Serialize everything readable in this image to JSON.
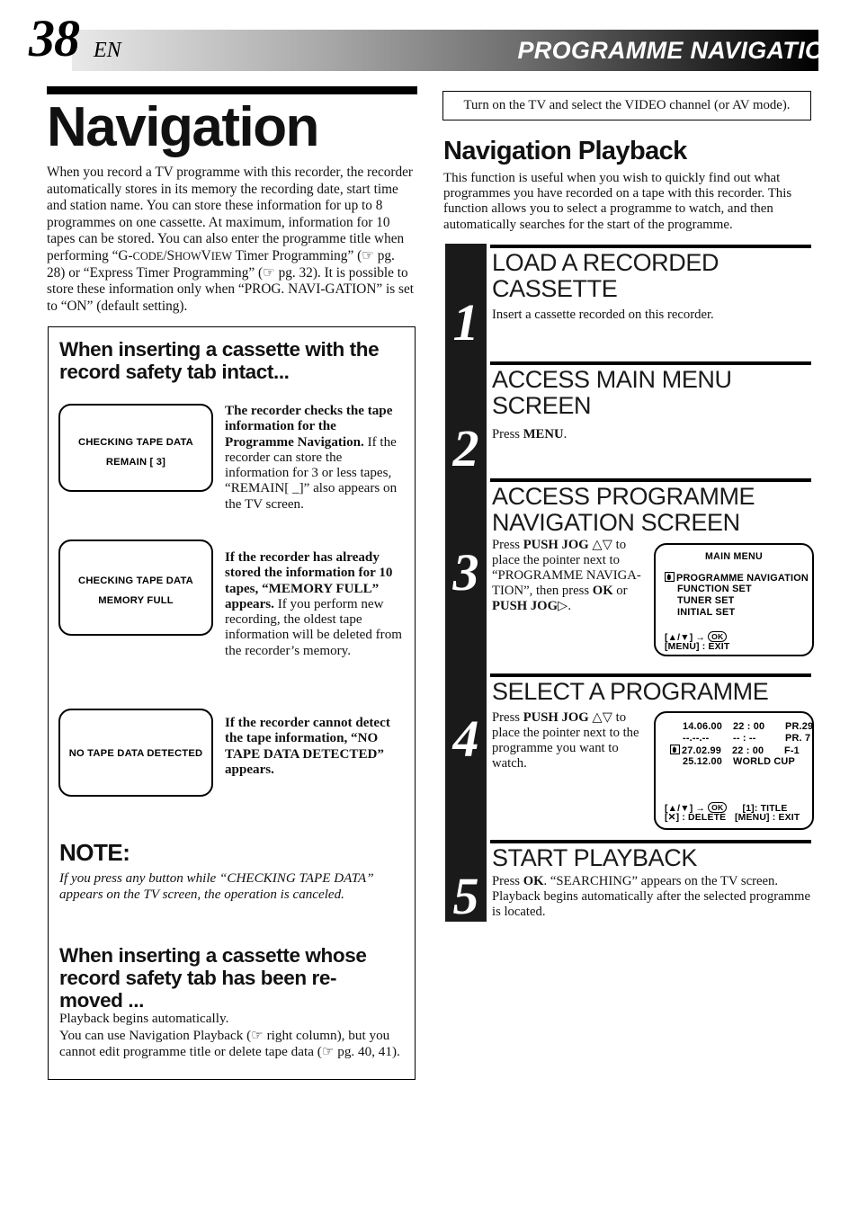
{
  "header": {
    "page_number": "38",
    "language": "EN",
    "title": "PROGRAMME NAVIGATION"
  },
  "left": {
    "heading": "Navigation",
    "intro": "When you record a TV programme with this recorder, the recorder automatically stores in its memory the recording date, start time and station name. You can store these information for up to 8 programmes on one cassette. At maximum, information for 10 tapes can be stored. You can also enter the programme title when performing “G-CODE/SHOWVIEW Timer Programming” (☞ pg. 28) or “Express Timer Programming” (☞ pg. 32). It is possible to store these information only when “PROG. NAVIGATION” is set to “ON” (default setting).",
    "box": {
      "heading_1": "When inserting a cassette with the record safety tab intact...",
      "heading_2": "When inserting a cassette whose record safety tab has been re-moved ...",
      "cases": [
        {
          "screen_line_1": "CHECKING TAPE DATA",
          "screen_line_2": "REMAIN [ 3]",
          "desc_bold": "The recorder checks the tape information for the Programme Navigation.",
          "desc_rest": "If the recorder can store the information for 3 or less tapes, “REMAIN[ _]” also appears on the TV screen."
        },
        {
          "screen_line_1": "CHECKING TAPE DATA",
          "screen_line_2": "MEMORY FULL",
          "desc_bold": "If the recorder has already stored the information for 10 tapes, “MEMORY FULL” appears.",
          "desc_rest": "If you perform new recording, the oldest tape information will be deleted from the recorder’s memory."
        },
        {
          "screen_line_1": "NO TAPE DATA DETECTED",
          "screen_line_2": "",
          "desc_bold": "If the recorder cannot detect the tape information, “NO TAPE DATA DETECTED” appears.",
          "desc_rest": ""
        }
      ],
      "note_heading": "NOTE:",
      "note_body": "If you press any button while “CHECKING TAPE DATA” appears on the TV screen, the operation is canceled.",
      "tab_removed_body": "Playback begins automatically.\nYou can use Navigation Playback (☞ right column), but you cannot edit programme title or delete tape data (☞ pg. 40, 41)."
    }
  },
  "right": {
    "tv_note": "Turn on the TV and select the VIDEO channel (or AV mode).",
    "section_title": "Navigation Playback",
    "section_intro": "This function is useful when you wish to quickly find out what programmes you have recorded on a tape with this recorder. This function allows you to select a programme to watch, and then automatically searches for the start of the programme.",
    "steps": [
      {
        "number": "1",
        "title": "LOAD A RECORDED CASSETTE",
        "body": "Insert a cassette recorded on this recorder."
      },
      {
        "number": "2",
        "title": "ACCESS MAIN MENU SCREEN",
        "body": "Press MENU."
      },
      {
        "number": "3",
        "title": "ACCESS PROGRAMME NAVIGATION SCREEN",
        "body": "Press PUSH JOG △▽ to place the pointer next to “PROGRAMME NAVIGA-TION”, then press OK or PUSH JOG ▷."
      },
      {
        "number": "4",
        "title": "SELECT A PROGRAMME",
        "body": "Press PUSH JOG △▽ to place the pointer next to the programme you want to watch."
      },
      {
        "number": "5",
        "title": "START PLAYBACK",
        "body": "Press OK. “SEARCHING” appears on the TV screen. Playback begins automatically after the selected programme is located."
      }
    ],
    "osd_main_menu": {
      "title": "MAIN MENU",
      "items": [
        "PROGRAMME NAVIGATION",
        "FUNCTION SET",
        "TUNER SET",
        "INITIAL SET"
      ],
      "selected_index": 0,
      "footer_line_1_left": "[▲/▼] →",
      "footer_line_1_ok": "OK",
      "footer_line_2": "[MENU] : EXIT"
    },
    "osd_programme_list": {
      "rows": [
        {
          "date": "14.06.00",
          "time": "22 : 00",
          "channel": "PR.29",
          "selected": false
        },
        {
          "date": "--.--.--",
          "time": "-- : --",
          "channel": "PR. 7",
          "selected": false
        },
        {
          "date": "27.02.99",
          "time": "22 : 00",
          "channel": "F-1",
          "selected": true
        },
        {
          "date": "25.12.00",
          "time": "WORLD CUP",
          "channel": "",
          "selected": false
        }
      ],
      "footer_line_1_left": "[▲/▼] →",
      "footer_line_1_ok": "OK",
      "footer_line_1_right": "[1]: TITLE",
      "footer_line_2_left": "[✕] : DELETE",
      "footer_line_2_right": "[MENU] : EXIT"
    }
  },
  "colors": {
    "ink": "#000000",
    "rail": "#1a1a1a",
    "paper": "#ffffff"
  }
}
